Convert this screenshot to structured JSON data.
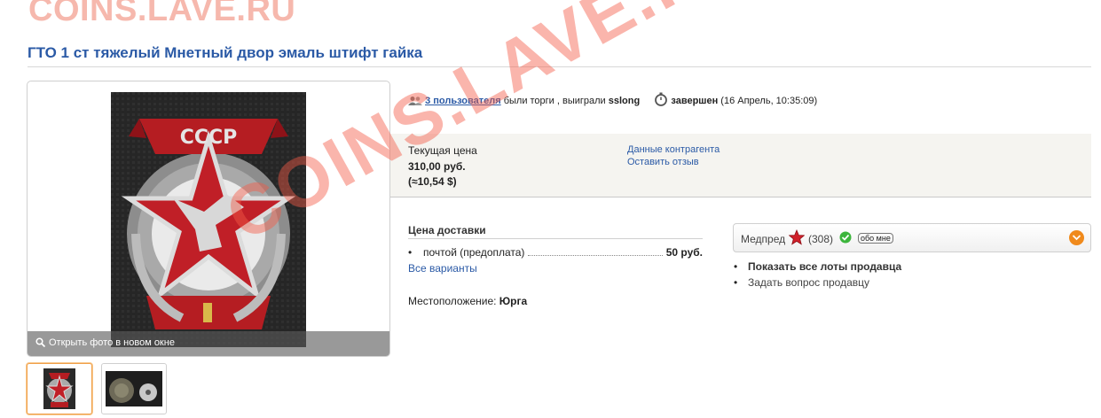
{
  "site": {
    "logo": "COINS.LAVE.RU"
  },
  "lot": {
    "title": "ГТО 1 ст тяжелый Мнетный двор эмаль штифт гайка"
  },
  "photo": {
    "open_label": "Открыть фото в новом окне"
  },
  "auction": {
    "users_link": "3 пользователя",
    "bids_text": " были торги , выиграли ",
    "winner": "sslong",
    "status": "завершен",
    "end_time": "(16 Апрель, 10:35:09)"
  },
  "price": {
    "label": "Текущая цена",
    "value": "310,00 руб.",
    "usd": "(≈10,54 $)",
    "counterparty_link": "Данные контрагента",
    "feedback_link": "Оставить отзыв"
  },
  "delivery": {
    "heading": "Цена доставки",
    "method": "почтой (предоплата)",
    "price": "50 руб.",
    "all_variants": "Все варианты"
  },
  "location": {
    "label": "Местоположение: ",
    "value": "Юрга"
  },
  "seller": {
    "name": "Медпред",
    "rating": "(308)",
    "about_me": "обо мне",
    "show_lots": "Показать все лоты продавца",
    "ask_question": "Задать вопрос продавцу"
  },
  "watermark": "COINS.LAVE.RU",
  "colors": {
    "link": "#2b5aa6",
    "accent": "#f08a1c",
    "watermark": "#f55a46"
  }
}
